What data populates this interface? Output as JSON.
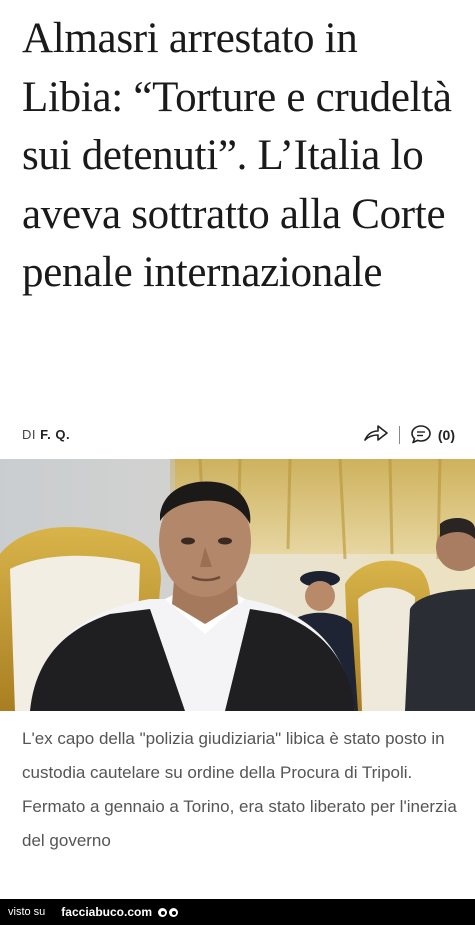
{
  "article": {
    "title": "Almasri arrestato in Libia: “Torture e crudeltà sui detenuti”. L’Italia lo aveva sottratto alla Corte penale internazionale",
    "byline_prefix": "DI",
    "author": "F. Q.",
    "comments_count": "(0)",
    "caption": "L'ex capo della \"polizia giudiziaria\" libica è stato posto in custodia cautelare su ordine della Procura di Tripoli. Fermato a gennaio a Torino, era stato liberato per l'inerzia del governo"
  },
  "icons": {
    "share": "share-arrow-icon",
    "comment": "comment-bubble-icon"
  },
  "footer": {
    "prefix": "visto su",
    "brand": "facciabuco.com"
  },
  "colors": {
    "headline": "#1a1a1a",
    "caption": "#555555",
    "footer_bg": "#000000"
  }
}
